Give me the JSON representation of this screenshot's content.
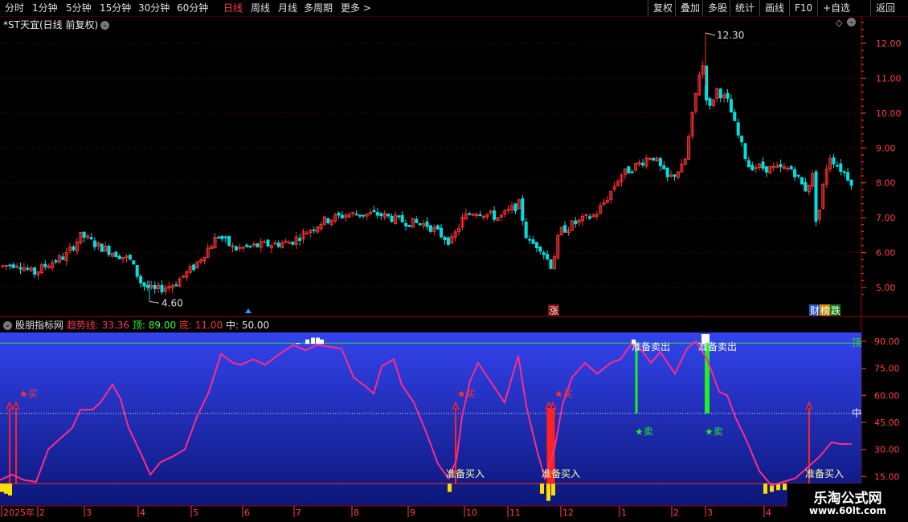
{
  "toolbar": {
    "left": [
      "分时",
      "1分钟",
      "5分钟",
      "15分钟",
      "30分钟",
      "60分钟",
      "日线",
      "周线",
      "月线",
      "多周期",
      "更多"
    ],
    "active": "日线",
    "more_arrow": ">",
    "right": [
      "复权",
      "叠加",
      "多股",
      "统计",
      "画线",
      "F10",
      "+自选",
      "返回"
    ]
  },
  "stock_title": "*ST天宜(日线 前复权)",
  "price_axis": [
    "12.00",
    "11.00",
    "10.00",
    "9.00",
    "8.00",
    "7.00",
    "6.00",
    "5.00"
  ],
  "price_markers": {
    "high": "12.30",
    "low": "4.60",
    "zhang": "涨",
    "cai": "财",
    "bang": "榜",
    "die": "跌"
  },
  "indicator": {
    "name": "股朋指标网",
    "trend_label": "趋势线: 33.36",
    "top_label": "顶: 89.00",
    "bottom_label": "底: 11.00",
    "mid_label": "中: 50.00",
    "axis": [
      "90.00",
      "75.00",
      "60.00",
      "45.00",
      "30.00",
      "15.00"
    ],
    "top_tag": "顶",
    "mid_tag": "中",
    "buy_prepare": "准备买入",
    "sell_prepare": "准备卖出",
    "buy_star": "★买",
    "sell_star": "★卖"
  },
  "time_axis": [
    "2025年",
    "2",
    "3",
    "4",
    "5",
    "6",
    "7",
    "8",
    "9",
    "10",
    "11",
    "12",
    "1",
    "2",
    "3",
    "4"
  ],
  "watermark": {
    "line1": "乐淘公式网",
    "line2": "www.60lt.com"
  },
  "colors": {
    "up": "#ff3333",
    "down": "#00e0e0",
    "trend": "#ff2a8a",
    "grid": "#7a0000",
    "axis": "#ff4040",
    "sell": "#22ee22",
    "buy": "#ff2222"
  }
}
